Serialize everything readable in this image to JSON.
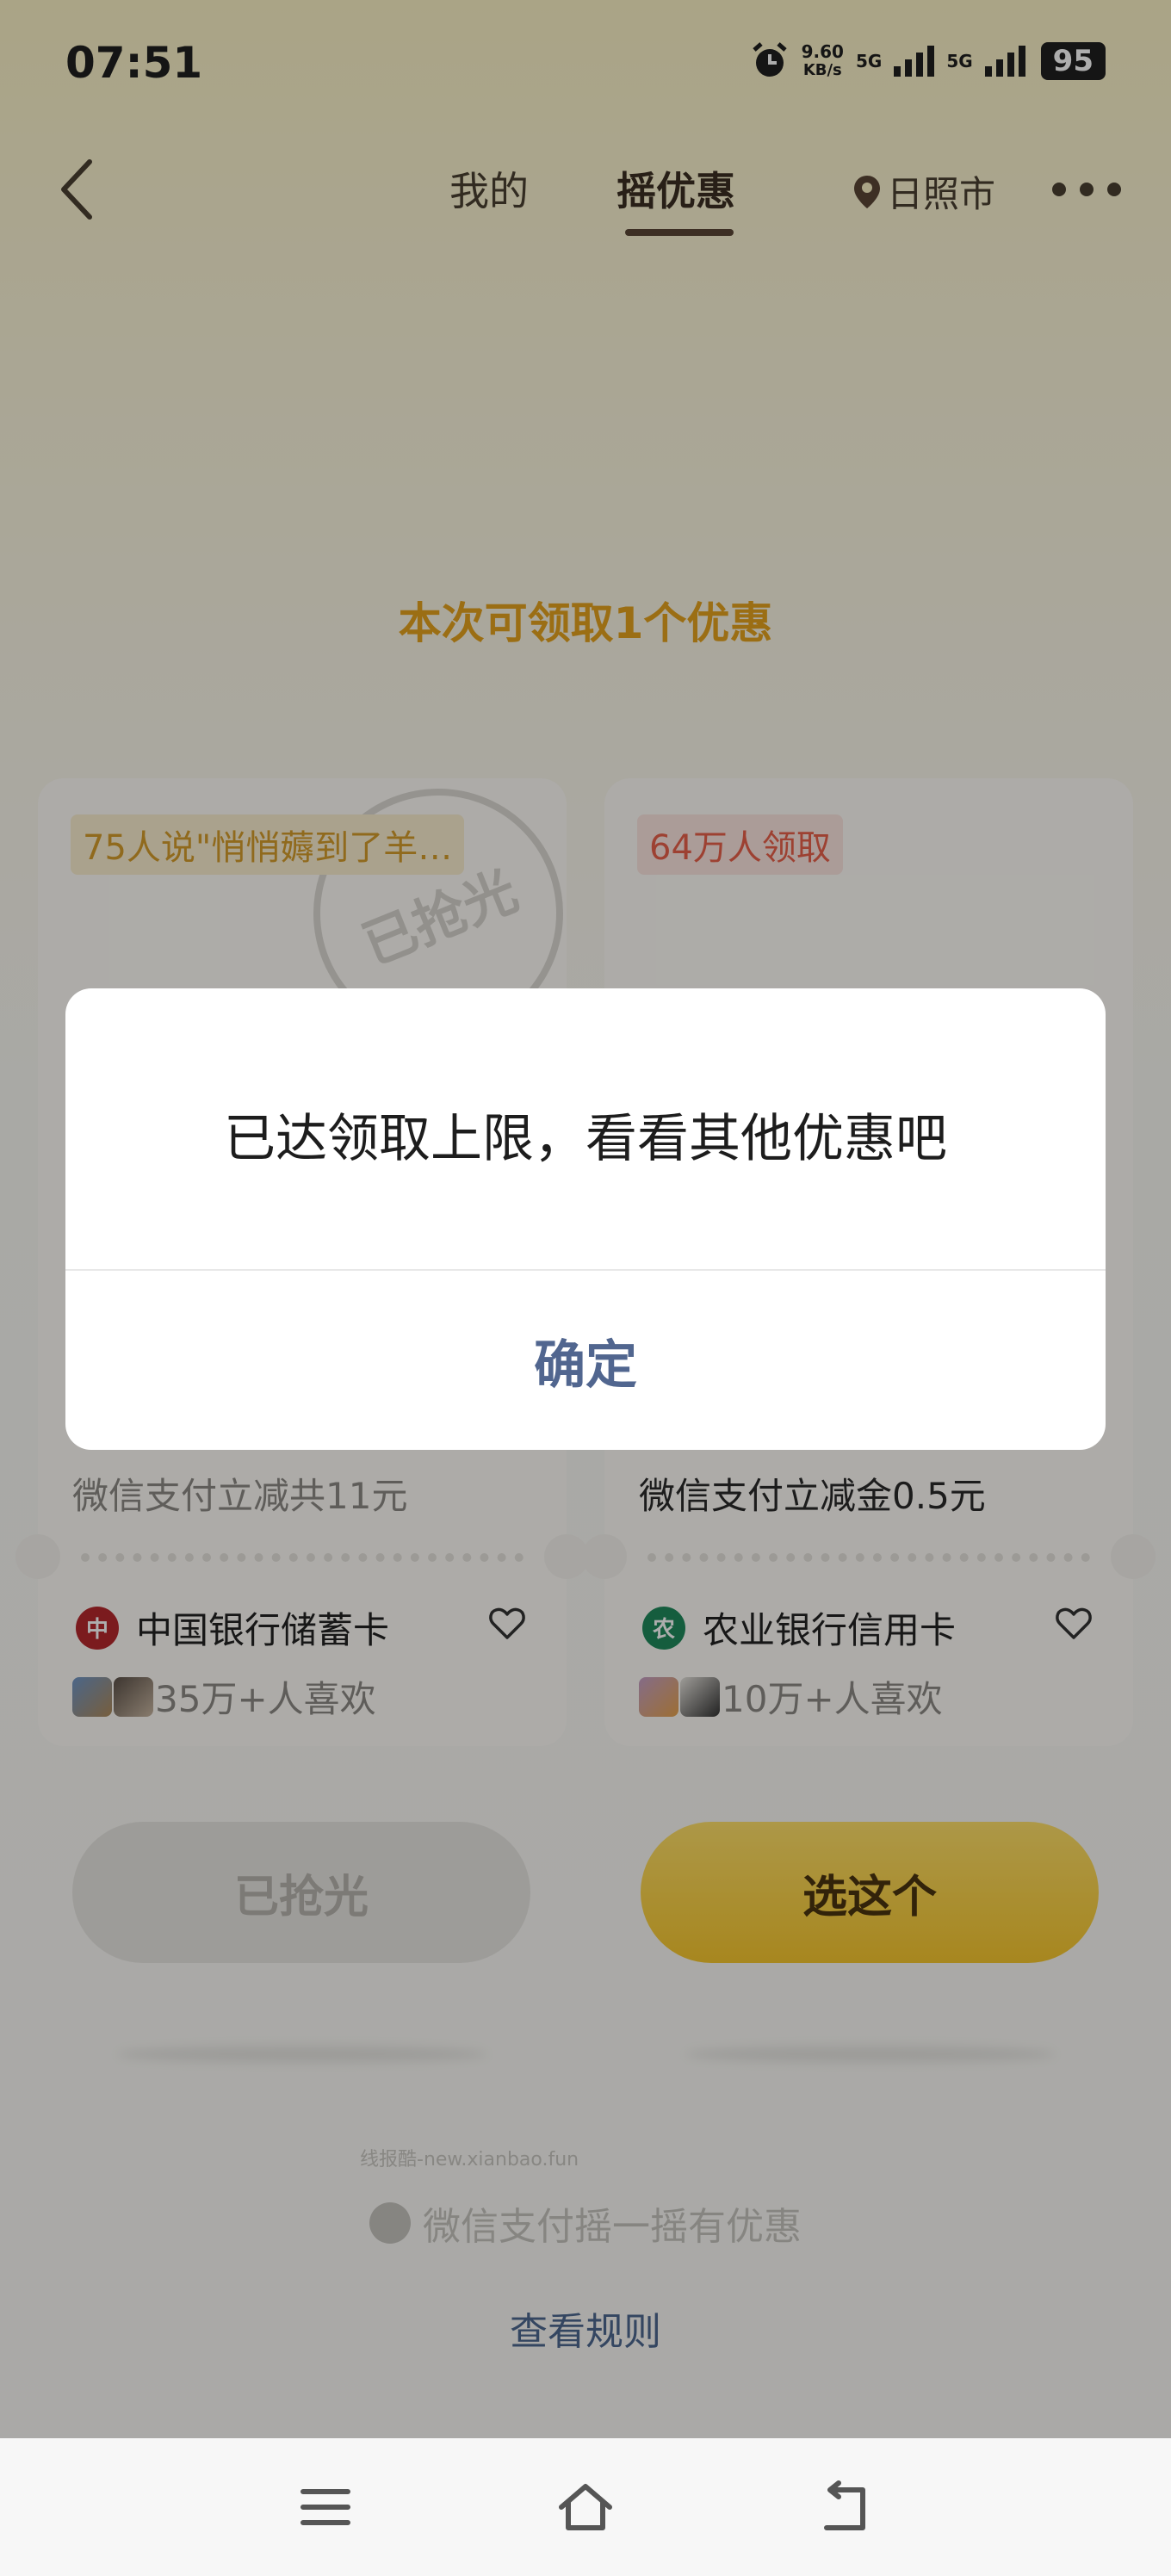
{
  "status_bar": {
    "time": "07:51",
    "speed_value": "9.60",
    "speed_unit": "KB/s",
    "net1": "5G",
    "net2": "5G",
    "battery": "95"
  },
  "nav": {
    "tab_mine": "我的",
    "tab_shake": "摇优惠",
    "location": "日照市"
  },
  "headline": "本次可领取1个优惠",
  "cards": [
    {
      "tag": "75人说\"悄悄薅到了羊…",
      "stamp": "已抢光",
      "desc": "微信支付立减共11元",
      "bank": "中国银行储蓄卡",
      "likes": "35万+人喜欢"
    },
    {
      "tag": "64万人领取",
      "desc": "微信支付立减金0.5元",
      "bank": "农业银行信用卡",
      "likes": "10万+人喜欢"
    }
  ],
  "buttons": {
    "sold_out": "已抢光",
    "pick": "选这个"
  },
  "watermark": "线报酷-new.xianbao.fun",
  "footer_brand": "微信支付摇一摇有优惠",
  "rules_link": "查看规则",
  "dialog": {
    "message": "已达领取上限，看看其他优惠吧",
    "confirm": "确定"
  },
  "colors": {
    "accent": "#e5a21e",
    "dialog_button": "#51668f",
    "boc_red": "#b5282d",
    "abc_green": "#1f8a5c"
  }
}
